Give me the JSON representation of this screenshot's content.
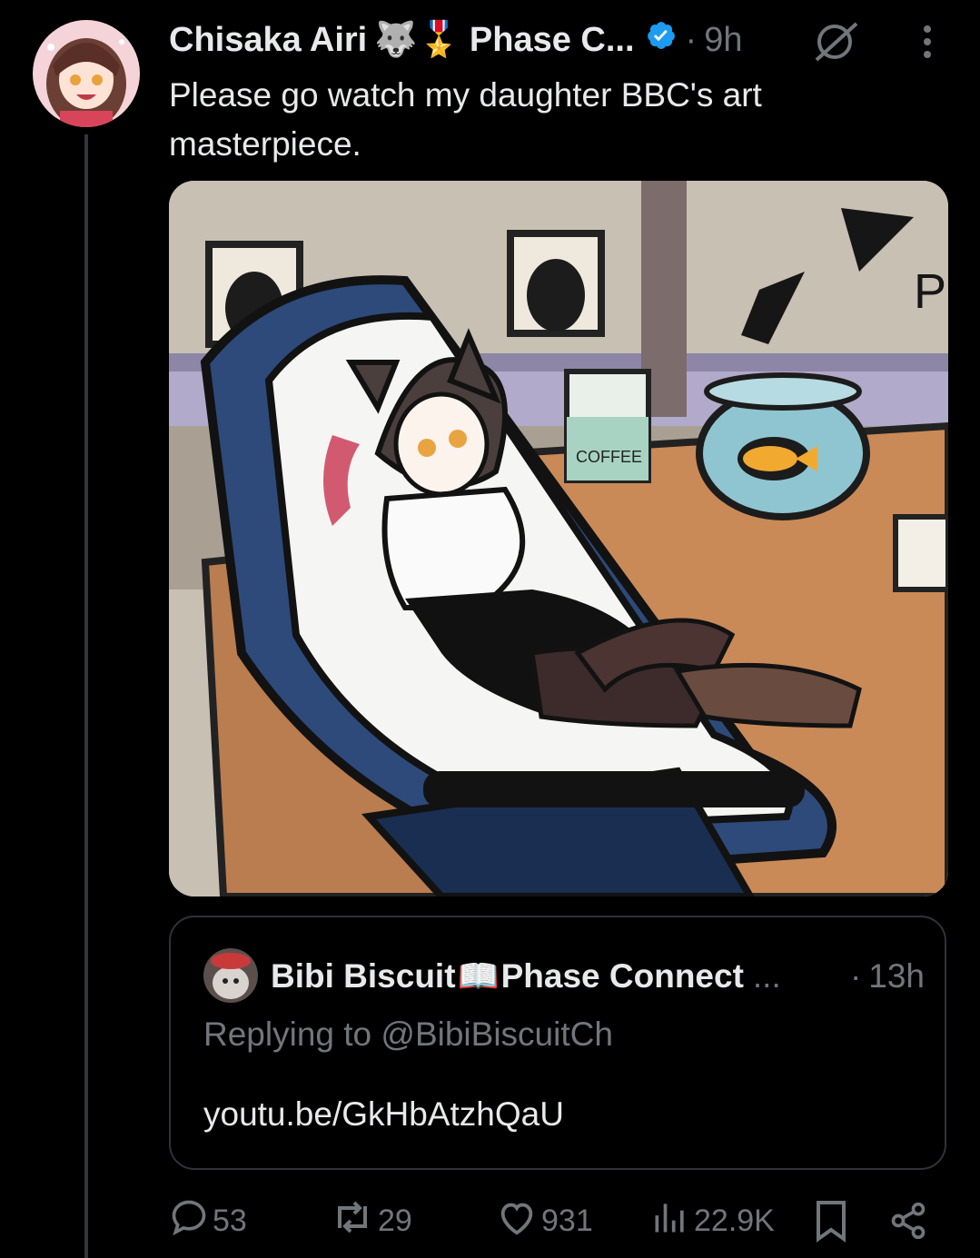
{
  "author": {
    "name": "Chisaka Airi",
    "emoji": "🐺🎖️",
    "affiliation": "Phase C...",
    "separator": "·",
    "time": "9h"
  },
  "post": {
    "text": "Please go watch my daughter BBC's art masterpiece."
  },
  "media": {
    "coffee_label": "COFFEE",
    "wall_letter": "P"
  },
  "quote": {
    "name": "Bibi Biscuit",
    "book_emoji": "📖",
    "affiliation": "Phase Connect",
    "ellipsis": "...",
    "separator": "·",
    "time": "13h",
    "replying_prefix": "Replying to",
    "replying_handle": "@BibiBiscuitCh",
    "link": "youtu.be/GkHbAtzhQaU"
  },
  "actions": {
    "replies": "53",
    "reposts": "29",
    "likes": "931",
    "views": "22.9K"
  },
  "colors": {
    "background": "#000000",
    "text": "#e7e9ea",
    "muted": "#71767b",
    "verified": "#1d9bf0",
    "border": "#2f3336"
  },
  "icons": [
    "grok-icon",
    "more-icon",
    "verified-icon",
    "reply-icon",
    "repost-icon",
    "like-icon",
    "views-icon",
    "bookmark-icon",
    "share-icon"
  ]
}
